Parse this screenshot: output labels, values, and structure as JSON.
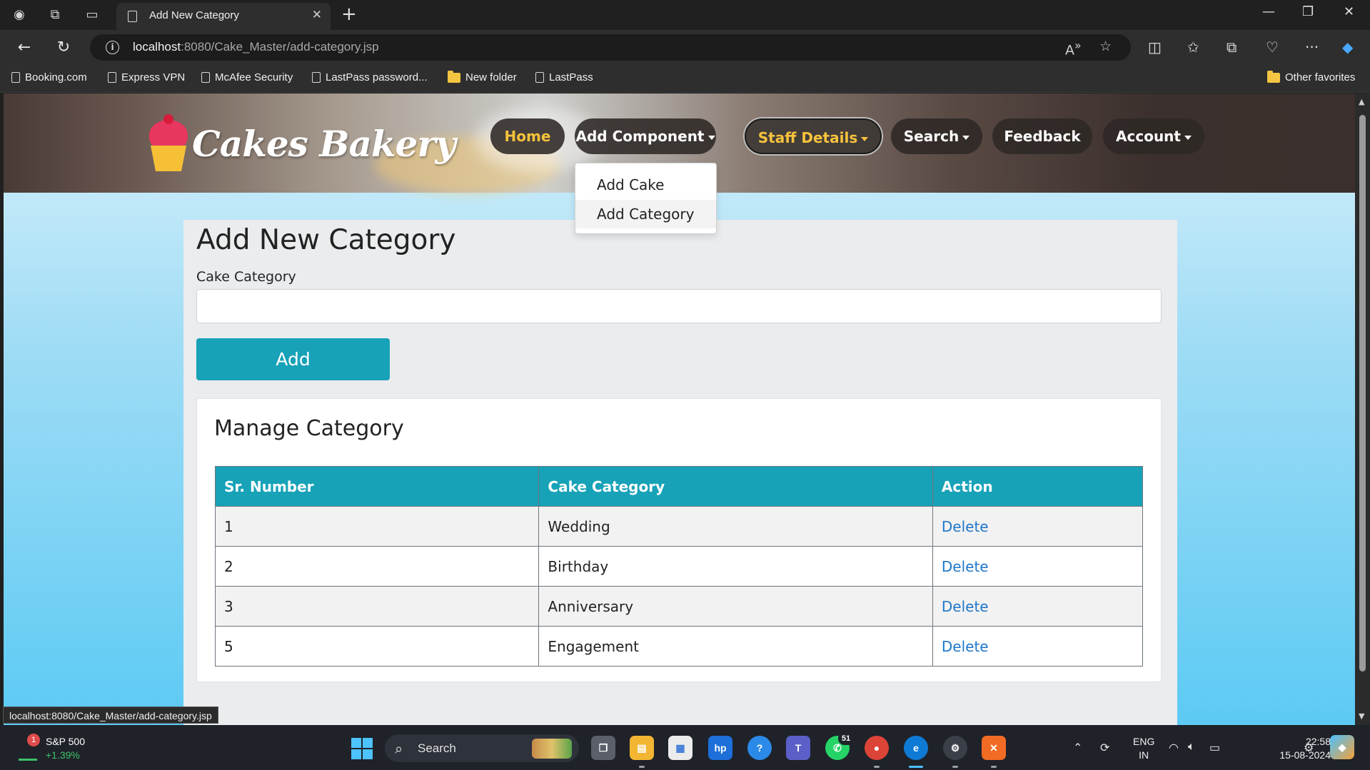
{
  "browser": {
    "tab_title": "Add New Category",
    "url_host": "localhost",
    "url_rest": ":8080/Cake_Master/add-category.jsp",
    "status_url": "localhost:8080/Cake_Master/add-category.jsp",
    "favorites": [
      {
        "label": "Booking.com",
        "icon": "page-icon"
      },
      {
        "label": "Express VPN",
        "icon": "page-icon"
      },
      {
        "label": "McAfee Security",
        "icon": "page-icon"
      },
      {
        "label": "LastPass password...",
        "icon": "page-icon"
      },
      {
        "label": "New folder",
        "icon": "folder-icon"
      },
      {
        "label": "LastPass",
        "icon": "page-icon"
      }
    ],
    "other_favorites": "Other favorites"
  },
  "site": {
    "logo_text": "Cakes Bakery",
    "nav": {
      "home": "Home",
      "add_component": "Add Component",
      "staff_details": "Staff Details",
      "search": "Search",
      "feedback": "Feedback",
      "account": "Account"
    },
    "dropdown": [
      "Add Cake",
      "Add Category"
    ],
    "colors": {
      "accent": "#17a2b8",
      "nav_highlight": "#f7c23c",
      "link": "#1f77c9"
    }
  },
  "form": {
    "title": "Add New Category",
    "field_label": "Cake Category",
    "field_value": "",
    "submit_label": "Add"
  },
  "manage": {
    "title": "Manage Category",
    "columns": [
      "Sr. Number",
      "Cake Category",
      "Action"
    ],
    "rows": [
      {
        "sr": "1",
        "category": "Wedding",
        "action": "Delete"
      },
      {
        "sr": "2",
        "category": "Birthday",
        "action": "Delete"
      },
      {
        "sr": "3",
        "category": "Anniversary",
        "action": "Delete"
      },
      {
        "sr": "5",
        "category": "Engagement",
        "action": "Delete"
      }
    ]
  },
  "taskbar": {
    "stock_badge": "1",
    "stock_name": "S&P 500",
    "stock_change": "+1.39%",
    "search_label": "Search",
    "whatsapp_badge": "51",
    "lang_line1": "ENG",
    "lang_line2": "IN",
    "time": "22:58",
    "date": "15-08-2024"
  }
}
